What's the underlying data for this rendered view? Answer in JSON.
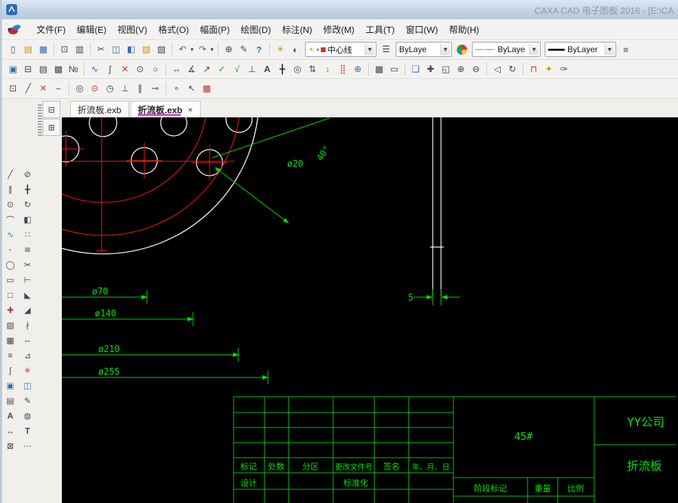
{
  "window": {
    "title": "CAXA CAD 电子图板 2016 - [E:\\CA"
  },
  "menubar": {
    "items": [
      {
        "name": "menu-file",
        "label": "文件(F)"
      },
      {
        "name": "menu-edit",
        "label": "编辑(E)"
      },
      {
        "name": "menu-view",
        "label": "视图(V)"
      },
      {
        "name": "menu-format",
        "label": "格式(O)"
      },
      {
        "name": "menu-paper",
        "label": "幅面(P)"
      },
      {
        "name": "menu-draw",
        "label": "绘图(D)"
      },
      {
        "name": "menu-dimension",
        "label": "标注(N)"
      },
      {
        "name": "menu-modify",
        "label": "修改(M)"
      },
      {
        "name": "menu-tools",
        "label": "工具(T)"
      },
      {
        "name": "menu-window",
        "label": "窗口(W)"
      },
      {
        "name": "menu-help",
        "label": "帮助(H)"
      }
    ]
  },
  "toolbar": {
    "layer_value": "中心线",
    "color_value": "ByLaye",
    "linetype_value": "ByLaye",
    "linetype_preview": "—·—·",
    "lineweight_value": "ByLayer",
    "row1a": [
      {
        "name": "new-file-icon",
        "glyph": "▯",
        "cls": "c-dark"
      },
      {
        "name": "open-file-icon",
        "glyph": "▤",
        "cls": "c-yellow"
      },
      {
        "name": "save-file-icon",
        "glyph": "▦",
        "cls": "c-blue"
      },
      {
        "name": "separator",
        "glyph": "",
        "cls": "tsep",
        "ni": true
      },
      {
        "name": "plot-icon",
        "glyph": "⊡",
        "cls": "c-dark"
      },
      {
        "name": "print-preview-icon",
        "glyph": "▥",
        "cls": "c-dark"
      },
      {
        "name": "separator",
        "glyph": "",
        "cls": "tsep",
        "ni": true
      },
      {
        "name": "cut-icon",
        "glyph": "✂",
        "cls": "c-dark"
      },
      {
        "name": "copy-icon",
        "glyph": "◫",
        "cls": "c-blue"
      },
      {
        "name": "copy-with-basepoint-icon",
        "glyph": "◧",
        "cls": "c-blue"
      },
      {
        "name": "paste-icon",
        "glyph": "▧",
        "cls": "c-yellow"
      },
      {
        "name": "paste-special-icon",
        "glyph": "▨",
        "cls": "c-dark"
      },
      {
        "name": "separator",
        "glyph": "",
        "cls": "tsep",
        "ni": true
      },
      {
        "name": "undo-icon",
        "glyph": "↶",
        "cls": "c-blue"
      },
      {
        "name": "undo-dropdown-icon",
        "glyph": "▾",
        "cls": "c-dark narrow"
      },
      {
        "name": "redo-icon",
        "glyph": "↷",
        "cls": "c-blue"
      },
      {
        "name": "redo-dropdown-icon",
        "glyph": "▾",
        "cls": "c-dark narrow"
      },
      {
        "name": "separator",
        "glyph": "",
        "cls": "tsep",
        "ni": true
      },
      {
        "name": "ole-object-icon",
        "glyph": "⊕",
        "cls": "c-dark"
      },
      {
        "name": "format-painter-icon",
        "glyph": "✎",
        "cls": "c-dark"
      },
      {
        "name": "help-icon",
        "glyph": "?",
        "cls": "c-blue bold"
      },
      {
        "name": "separator",
        "glyph": "",
        "cls": "tsep",
        "ni": true
      },
      {
        "name": "layer-bulb-icon",
        "glyph": "☀",
        "cls": "c-yellow"
      },
      {
        "name": "layer-lock-icon",
        "glyph": "◐",
        "cls": "c-dark"
      }
    ],
    "row1b": [
      {
        "name": "layer-manager-icon",
        "glyph": "☰",
        "cls": "c-dark"
      }
    ],
    "row1c": [
      {
        "name": "color-palette-icon",
        "glyph": "",
        "cls": "ball"
      }
    ],
    "row1e": [
      {
        "name": "lineweight-settings-icon",
        "glyph": "≡",
        "cls": "c-dark"
      }
    ],
    "row2": [
      {
        "name": "paper-settings-icon",
        "glyph": "▣",
        "cls": "c-blue"
      },
      {
        "name": "title-block-tool-icon",
        "glyph": "⊟",
        "cls": "c-dark"
      },
      {
        "name": "parts-list-icon",
        "glyph": "▤",
        "cls": "c-dark"
      },
      {
        "name": "frame-fill-icon",
        "glyph": "▩",
        "cls": "c-dark"
      },
      {
        "name": "serial-number-icon",
        "glyph": "№",
        "cls": "c-dark"
      },
      {
        "name": "separator",
        "glyph": "",
        "cls": "tsep",
        "ni": true
      },
      {
        "name": "wave-line-icon",
        "glyph": "∿",
        "cls": "c-blue"
      },
      {
        "name": "formula-curve-icon",
        "glyph": "∫",
        "cls": "c-dark"
      },
      {
        "name": "delete-tool-icon",
        "glyph": "✕",
        "cls": "c-red"
      },
      {
        "name": "snap-point-icon",
        "glyph": "⊙",
        "cls": "c-dark"
      },
      {
        "name": "contour-icon",
        "glyph": "○",
        "cls": "c-dark"
      },
      {
        "name": "separator",
        "glyph": "",
        "cls": "tsep",
        "ni": true
      },
      {
        "name": "dim-linear-icon",
        "glyph": "↔",
        "cls": "c-dark"
      },
      {
        "name": "dim-angular-icon",
        "glyph": "∡",
        "cls": "c-dark"
      },
      {
        "name": "leader-icon",
        "glyph": "↗",
        "cls": "c-dark"
      },
      {
        "name": "check-dim-icon",
        "glyph": "✓",
        "cls": "c-green"
      },
      {
        "name": "roughness-icon",
        "glyph": "√",
        "cls": "c-green"
      },
      {
        "name": "datum-icon",
        "glyph": "⊥",
        "cls": "c-dark"
      },
      {
        "name": "text-tool-icon",
        "glyph": "A",
        "cls": "c-dark bold"
      },
      {
        "name": "coordinate-dim-icon",
        "glyph": "╋",
        "cls": "c-dark"
      },
      {
        "name": "balloon-icon",
        "glyph": "◎",
        "cls": "c-dark"
      },
      {
        "name": "section-symbol-icon",
        "glyph": "⇅",
        "cls": "c-dark"
      },
      {
        "name": "arrow-tool-icon",
        "glyph": "↓",
        "cls": "c-green"
      },
      {
        "name": "point-array-icon",
        "glyph": "⣿",
        "cls": "c-red"
      },
      {
        "name": "center-mark-icon",
        "glyph": "⊕",
        "cls": "c-blue"
      },
      {
        "name": "separator",
        "glyph": "",
        "cls": "tsep",
        "ni": true
      },
      {
        "name": "grid-toggle-icon",
        "glyph": "▦",
        "cls": "c-dark"
      },
      {
        "name": "ruler-icon",
        "glyph": "▭",
        "cls": "c-dark"
      },
      {
        "name": "separator",
        "glyph": "",
        "cls": "tsep",
        "ni": true
      },
      {
        "name": "zoom-window-icon",
        "glyph": "❑",
        "cls": "c-blue"
      },
      {
        "name": "pan-view-icon",
        "glyph": "✚",
        "cls": "c-dark"
      },
      {
        "name": "zoom-all-icon",
        "glyph": "◱",
        "cls": "c-dark"
      },
      {
        "name": "zoom-in-icon",
        "glyph": "⊕",
        "cls": "c-dark"
      },
      {
        "name": "zoom-out-icon",
        "glyph": "⊖",
        "cls": "c-dark"
      },
      {
        "name": "separator",
        "glyph": "",
        "cls": "tsep",
        "ni": true
      },
      {
        "name": "previous-view-icon",
        "glyph": "◁",
        "cls": "c-dark"
      },
      {
        "name": "redraw-icon",
        "glyph": "↻",
        "cls": "c-dark"
      },
      {
        "name": "separator",
        "glyph": "",
        "cls": "tsep",
        "ni": true
      },
      {
        "name": "frame-select-icon",
        "glyph": "⊓",
        "cls": "c-red"
      },
      {
        "name": "highlight-icon",
        "glyph": "✦",
        "cls": "c-yellow"
      },
      {
        "name": "pen-icon",
        "glyph": "✑",
        "cls": "c-dark"
      }
    ],
    "row3": [
      {
        "name": "snap-settings-icon",
        "glyph": "⊡",
        "cls": "c-dark"
      },
      {
        "name": "segment-icon",
        "glyph": "╱",
        "cls": "c-dark"
      },
      {
        "name": "erase-segment-icon",
        "glyph": "✕",
        "cls": "c-red"
      },
      {
        "name": "dash-line-icon",
        "glyph": "−",
        "cls": "c-dark"
      },
      {
        "name": "separator",
        "glyph": "",
        "cls": "tsep",
        "ni": true
      },
      {
        "name": "concentric-icon",
        "glyph": "◎",
        "cls": "c-dark"
      },
      {
        "name": "center-snap-icon",
        "glyph": "⊙",
        "cls": "c-red"
      },
      {
        "name": "quadrant-icon",
        "glyph": "◷",
        "cls": "c-dark"
      },
      {
        "name": "perpendicular-icon",
        "glyph": "⊥",
        "cls": "c-dark"
      },
      {
        "name": "parallel-snap-icon",
        "glyph": "∥",
        "cls": "c-dark"
      },
      {
        "name": "tangent-icon",
        "glyph": "⊸",
        "cls": "c-dark"
      },
      {
        "name": "separator",
        "glyph": "",
        "cls": "tsep",
        "ni": true
      },
      {
        "name": "node-icon",
        "glyph": "∘",
        "cls": "c-dark"
      },
      {
        "name": "pick-cursor-icon",
        "glyph": "↖",
        "cls": "c-dark"
      },
      {
        "name": "library-icon",
        "glyph": "▦",
        "cls": "c-red"
      }
    ]
  },
  "left_panel": {
    "palette_buttons": [
      {
        "name": "options-palette-button",
        "glyph": "⊟",
        "cls": "c-dark"
      },
      {
        "name": "library-palette-button",
        "glyph": "⊞",
        "cls": "c-dark"
      }
    ],
    "col_a": [
      {
        "name": "draw-line-icon",
        "glyph": "╱",
        "cls": "c-dark"
      },
      {
        "name": "draw-parallel-icon",
        "glyph": "∥",
        "cls": "c-dark"
      },
      {
        "name": "draw-circle-icon",
        "glyph": "⊙",
        "cls": "c-dark"
      },
      {
        "name": "draw-arc-icon",
        "glyph": "⌒",
        "cls": "c-dark"
      },
      {
        "name": "draw-spline-icon",
        "glyph": "∿",
        "cls": "c-blue"
      },
      {
        "name": "draw-point-icon",
        "glyph": "·",
        "cls": "c-dark bold"
      },
      {
        "name": "draw-ellipse-icon",
        "glyph": "◯",
        "cls": "c-dark"
      },
      {
        "name": "draw-rectangle-icon",
        "glyph": "▭",
        "cls": "c-dark"
      },
      {
        "name": "draw-polygon-icon",
        "glyph": "□",
        "cls": "c-dark"
      },
      {
        "name": "draw-centerline-icon",
        "glyph": "✚",
        "cls": "c-red"
      },
      {
        "name": "draw-hatch-icon",
        "glyph": "▨",
        "cls": "c-dark"
      },
      {
        "name": "draw-fill-icon",
        "glyph": "▩",
        "cls": "c-dark"
      },
      {
        "name": "draw-multiline-icon",
        "glyph": "≡",
        "cls": "c-dark"
      },
      {
        "name": "draw-curve-icon",
        "glyph": "∫",
        "cls": "c-dark"
      },
      {
        "name": "draw-block-icon",
        "glyph": "▣",
        "cls": "c-blue"
      },
      {
        "name": "insert-image-icon",
        "glyph": "▤",
        "cls": "c-dark"
      },
      {
        "name": "draw-text-icon",
        "glyph": "A",
        "cls": "c-dark bold"
      },
      {
        "name": "draw-dimension-icon",
        "glyph": "↔",
        "cls": "c-dark"
      },
      {
        "name": "draw-wipeout-icon",
        "glyph": "⊠",
        "cls": "c-dark"
      }
    ],
    "col_b": [
      {
        "name": "erase-icon",
        "glyph": "⊘",
        "cls": "c-dark"
      },
      {
        "name": "move-icon",
        "glyph": "╋",
        "cls": "c-dark"
      },
      {
        "name": "rotate-icon",
        "glyph": "↻",
        "cls": "c-dark"
      },
      {
        "name": "mirror-icon",
        "glyph": "◧",
        "cls": "c-dark"
      },
      {
        "name": "array-icon",
        "glyph": "∷",
        "cls": "c-dark"
      },
      {
        "name": "offset-icon",
        "glyph": "≋",
        "cls": "c-dark"
      },
      {
        "name": "trim-icon",
        "glyph": "✂",
        "cls": "c-dark"
      },
      {
        "name": "extend-icon",
        "glyph": "⊢",
        "cls": "c-dark"
      },
      {
        "name": "corner-icon",
        "glyph": "◣",
        "cls": "c-dark"
      },
      {
        "name": "chamfer-icon",
        "glyph": "◢",
        "cls": "c-dark"
      },
      {
        "name": "break-icon",
        "glyph": "∤",
        "cls": "c-dark"
      },
      {
        "name": "stretch-icon",
        "glyph": "⇔",
        "cls": "c-dark"
      },
      {
        "name": "scale-icon",
        "glyph": "⊿",
        "cls": "c-dark"
      },
      {
        "name": "explode-icon",
        "glyph": "✳",
        "cls": "c-red"
      },
      {
        "name": "copy-entity-icon",
        "glyph": "◫",
        "cls": "c-blue"
      },
      {
        "name": "match-properties-icon",
        "glyph": "✎",
        "cls": "c-dark"
      },
      {
        "name": "fill-color-icon",
        "glyph": "◍",
        "cls": "c-dark"
      },
      {
        "name": "text-edit-icon",
        "glyph": "T",
        "cls": "c-dark bold"
      },
      {
        "name": "more-tools-icon",
        "glyph": "⋯",
        "cls": "c-dark"
      }
    ]
  },
  "tabs": {
    "inactive_label": "折流板.exb",
    "active_label": "折流板.exb",
    "close_glyph": "×"
  },
  "drawing": {
    "dim_d20": "ø20",
    "dim_a40": "40°",
    "dim_d70": "ø70",
    "dim_d140": "ø140",
    "dim_d210": "ø210",
    "dim_d255": "ø255",
    "dim_t5": "5",
    "colors": {
      "geometry": "#ffffff",
      "centerline": "#ff1a1a",
      "dimension": "#00e000",
      "background": "#000000"
    }
  },
  "title_block": {
    "c_mark": "标记",
    "c_count": "处数",
    "c_zone": "分区",
    "c_change_no": "更改文件号",
    "c_signature": "签名",
    "c_date": "年、月、日",
    "design": "设计",
    "standardization": "标准化",
    "stage_mark": "阶段标记",
    "weight": "重量",
    "scale": "比例",
    "material": "45#",
    "company": "YY公司",
    "part_name": "折流板"
  }
}
